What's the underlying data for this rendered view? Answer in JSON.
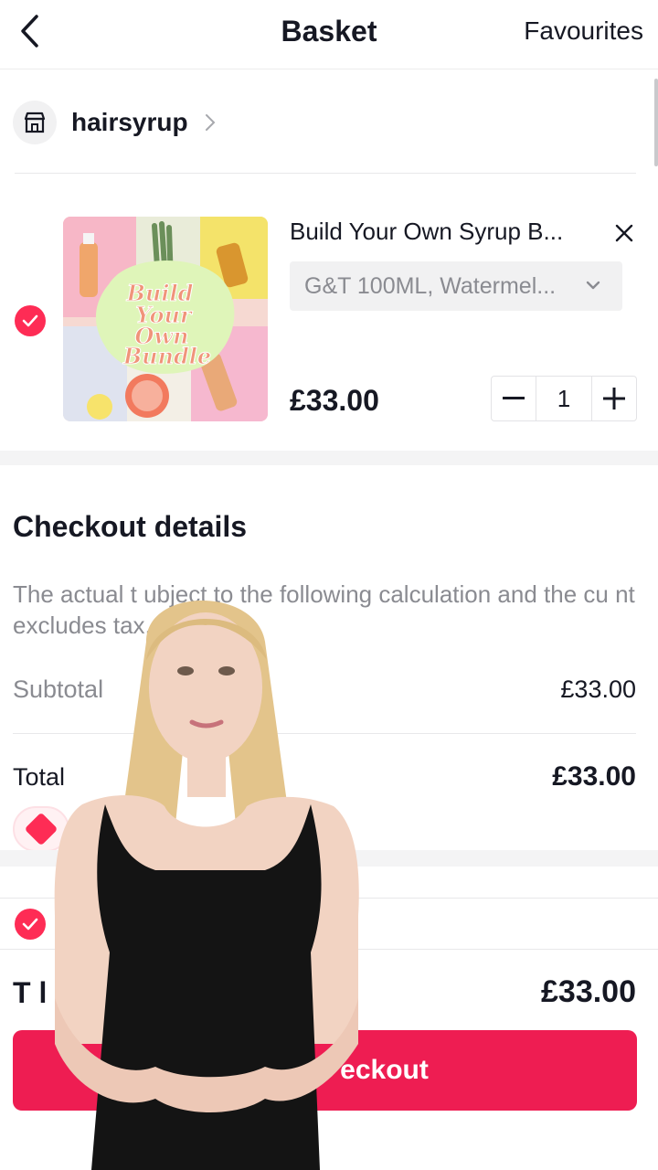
{
  "header": {
    "title": "Basket",
    "favourites_label": "Favourites",
    "back_icon": "chevron-left-icon"
  },
  "shop": {
    "name": "hairsyrup",
    "icon": "store-icon"
  },
  "cart_item": {
    "title": "Build Your Own Syrup B...",
    "variant": "G&T 100ML, Watermel...",
    "price": "£33.00",
    "quantity": "1",
    "selected": true,
    "image_text": [
      "Build",
      "Your",
      "Own",
      "Bundle"
    ]
  },
  "checkout_details": {
    "title": "Checkout details",
    "note": "The actual t          ubject to the following calculation and the cu              nt excludes tax.",
    "subtotal_label": "Subtotal",
    "subtotal_value": "£33.00",
    "total_label": "Total",
    "total_value": "£33.00"
  },
  "footer": {
    "total_label_visible": "T   l",
    "total_value": "£33.00",
    "checkout_label": "eckout"
  },
  "colors": {
    "accent": "#fe2c55",
    "checkout_button": "#ee1d52",
    "muted_text": "#8a8b91"
  }
}
